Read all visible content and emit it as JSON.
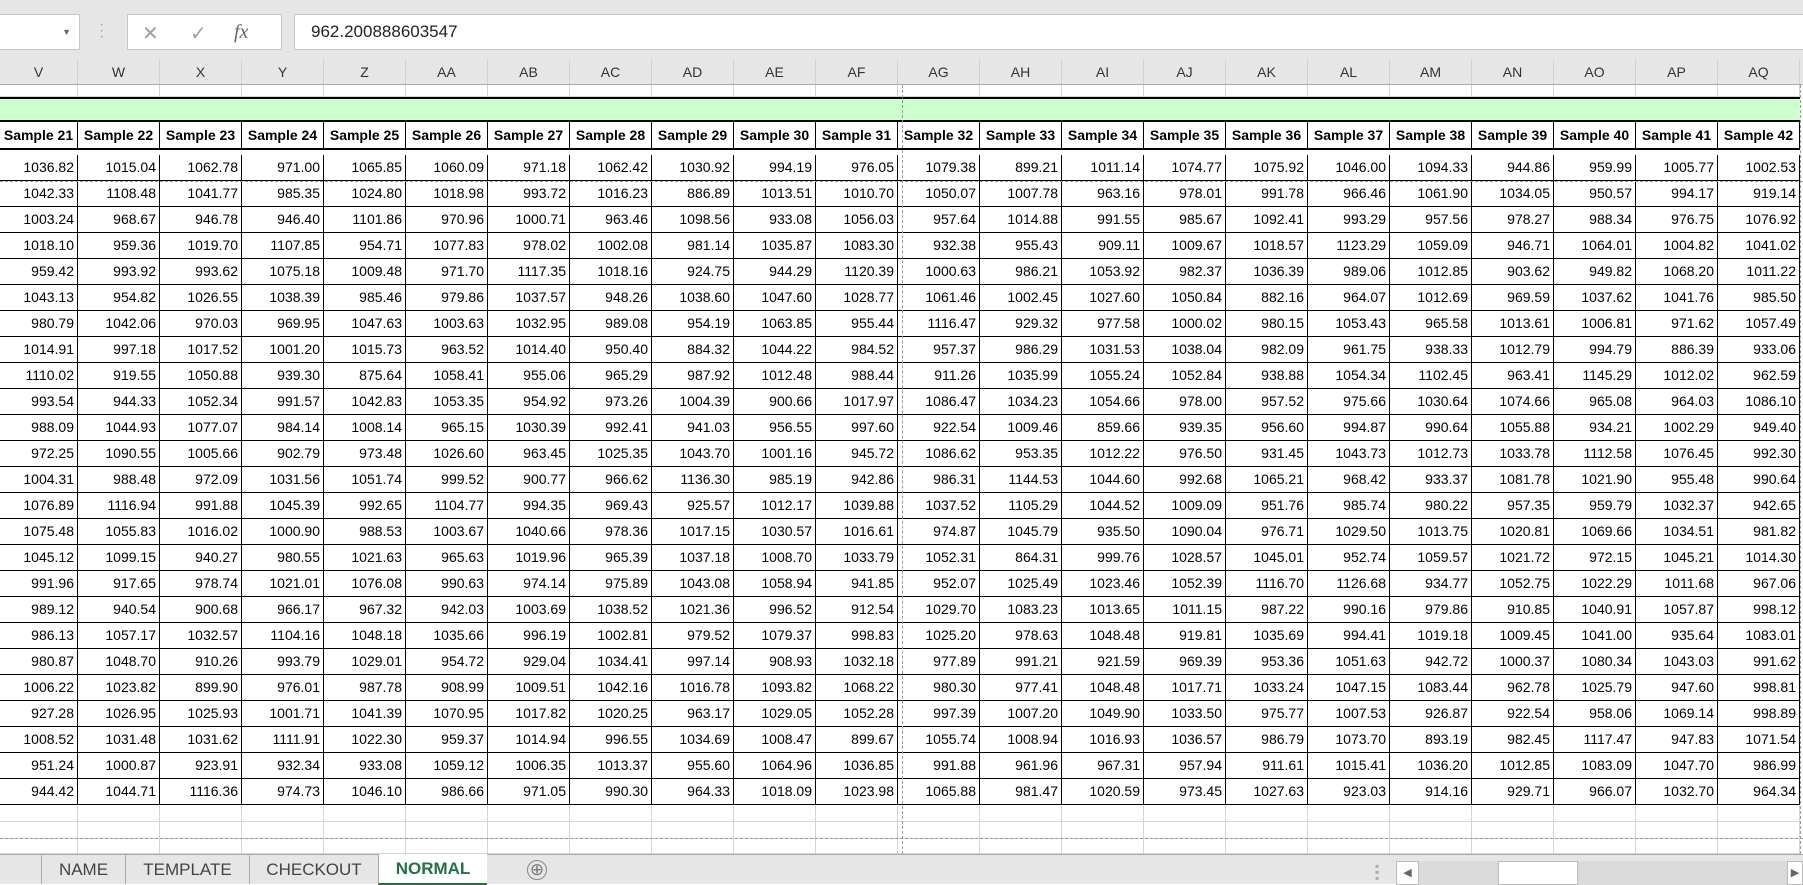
{
  "formula_bar": {
    "name_box": "",
    "cancel_icon": "✕",
    "enter_icon": "✓",
    "fx_label": "fx",
    "value": "962.200888603547"
  },
  "columns": [
    "V",
    "W",
    "X",
    "Y",
    "Z",
    "AA",
    "AB",
    "AC",
    "AD",
    "AE",
    "AF",
    "AG",
    "AH",
    "AI",
    "AJ",
    "AK",
    "AL",
    "AM",
    "AN",
    "AO",
    "AP",
    "AQ"
  ],
  "header_row": [
    "Sample 21",
    "Sample 22",
    "Sample 23",
    "Sample 24",
    "Sample 25",
    "Sample 26",
    "Sample 27",
    "Sample 28",
    "Sample 29",
    "Sample 30",
    "Sample 31",
    "Sample 32",
    "Sample 33",
    "Sample 34",
    "Sample 35",
    "Sample 36",
    "Sample 37",
    "Sample 38",
    "Sample 39",
    "Sample 40",
    "Sample 41",
    "Sample 42"
  ],
  "colors": {
    "header_fill": "#ccffcc",
    "active_tab_text": "#217346",
    "chrome": "#e6e6e6"
  },
  "rows": [
    [
      "1036.82",
      "1015.04",
      "1062.78",
      "971.00",
      "1065.85",
      "1060.09",
      "971.18",
      "1062.42",
      "1030.92",
      "994.19",
      "976.05",
      "1079.38",
      "899.21",
      "1011.14",
      "1074.77",
      "1075.92",
      "1046.00",
      "1094.33",
      "944.86",
      "959.99",
      "1005.77",
      "1002.53"
    ],
    [
      "1042.33",
      "1108.48",
      "1041.77",
      "985.35",
      "1024.80",
      "1018.98",
      "993.72",
      "1016.23",
      "886.89",
      "1013.51",
      "1010.70",
      "1050.07",
      "1007.78",
      "963.16",
      "978.01",
      "991.78",
      "966.46",
      "1061.90",
      "1034.05",
      "950.57",
      "994.17",
      "919.14"
    ],
    [
      "1003.24",
      "968.67",
      "946.78",
      "946.40",
      "1101.86",
      "970.96",
      "1000.71",
      "963.46",
      "1098.56",
      "933.08",
      "1056.03",
      "957.64",
      "1014.88",
      "991.55",
      "985.67",
      "1092.41",
      "993.29",
      "957.56",
      "978.27",
      "988.34",
      "976.75",
      "1076.92"
    ],
    [
      "1018.10",
      "959.36",
      "1019.70",
      "1107.85",
      "954.71",
      "1077.83",
      "978.02",
      "1002.08",
      "981.14",
      "1035.87",
      "1083.30",
      "932.38",
      "955.43",
      "909.11",
      "1009.67",
      "1018.57",
      "1123.29",
      "1059.09",
      "946.71",
      "1064.01",
      "1004.82",
      "1041.02"
    ],
    [
      "959.42",
      "993.92",
      "993.62",
      "1075.18",
      "1009.48",
      "971.70",
      "1117.35",
      "1018.16",
      "924.75",
      "944.29",
      "1120.39",
      "1000.63",
      "986.21",
      "1053.92",
      "982.37",
      "1036.39",
      "989.06",
      "1012.85",
      "903.62",
      "949.82",
      "1068.20",
      "1011.22"
    ],
    [
      "1043.13",
      "954.82",
      "1026.55",
      "1038.39",
      "985.46",
      "979.86",
      "1037.57",
      "948.26",
      "1038.60",
      "1047.60",
      "1028.77",
      "1061.46",
      "1002.45",
      "1027.60",
      "1050.84",
      "882.16",
      "964.07",
      "1012.69",
      "969.59",
      "1037.62",
      "1041.76",
      "985.50"
    ],
    [
      "980.79",
      "1042.06",
      "970.03",
      "969.95",
      "1047.63",
      "1003.63",
      "1032.95",
      "989.08",
      "954.19",
      "1063.85",
      "955.44",
      "1116.47",
      "929.32",
      "977.58",
      "1000.02",
      "980.15",
      "1053.43",
      "965.58",
      "1013.61",
      "1006.81",
      "971.62",
      "1057.49"
    ],
    [
      "1014.91",
      "997.18",
      "1017.52",
      "1001.20",
      "1015.73",
      "963.52",
      "1014.40",
      "950.40",
      "884.32",
      "1044.22",
      "984.52",
      "957.37",
      "986.29",
      "1031.53",
      "1038.04",
      "982.09",
      "961.75",
      "938.33",
      "1012.79",
      "994.79",
      "886.39",
      "933.06"
    ],
    [
      "1110.02",
      "919.55",
      "1050.88",
      "939.30",
      "875.64",
      "1058.41",
      "955.06",
      "965.29",
      "987.92",
      "1012.48",
      "988.44",
      "911.26",
      "1035.99",
      "1055.24",
      "1052.84",
      "938.88",
      "1054.34",
      "1102.45",
      "963.41",
      "1145.29",
      "1012.02",
      "962.59"
    ],
    [
      "993.54",
      "944.33",
      "1052.34",
      "991.57",
      "1042.83",
      "1053.35",
      "954.92",
      "973.26",
      "1004.39",
      "900.66",
      "1017.97",
      "1086.47",
      "1034.23",
      "1054.66",
      "978.00",
      "957.52",
      "975.66",
      "1030.64",
      "1074.66",
      "965.08",
      "964.03",
      "1086.10"
    ],
    [
      "988.09",
      "1044.93",
      "1077.07",
      "984.14",
      "1008.14",
      "965.15",
      "1030.39",
      "992.41",
      "941.03",
      "956.55",
      "997.60",
      "922.54",
      "1009.46",
      "859.66",
      "939.35",
      "956.60",
      "994.87",
      "990.64",
      "1055.88",
      "934.21",
      "1002.29",
      "949.40"
    ],
    [
      "972.25",
      "1090.55",
      "1005.66",
      "902.79",
      "973.48",
      "1026.60",
      "963.45",
      "1025.35",
      "1043.70",
      "1001.16",
      "945.72",
      "1086.62",
      "953.35",
      "1012.22",
      "976.50",
      "931.45",
      "1043.73",
      "1012.73",
      "1033.78",
      "1112.58",
      "1076.45",
      "992.30"
    ],
    [
      "1004.31",
      "988.48",
      "972.09",
      "1031.56",
      "1051.74",
      "999.52",
      "900.77",
      "966.62",
      "1136.30",
      "985.19",
      "942.86",
      "986.31",
      "1144.53",
      "1044.60",
      "992.68",
      "1065.21",
      "968.42",
      "933.37",
      "1081.78",
      "1021.90",
      "955.48",
      "990.64"
    ],
    [
      "1076.89",
      "1116.94",
      "991.88",
      "1045.39",
      "992.65",
      "1104.77",
      "994.35",
      "969.43",
      "925.57",
      "1012.17",
      "1039.88",
      "1037.52",
      "1105.29",
      "1044.52",
      "1009.09",
      "951.76",
      "985.74",
      "980.22",
      "957.35",
      "959.79",
      "1032.37",
      "942.65"
    ],
    [
      "1075.48",
      "1055.83",
      "1016.02",
      "1000.90",
      "988.53",
      "1003.67",
      "1040.66",
      "978.36",
      "1017.15",
      "1030.57",
      "1016.61",
      "974.87",
      "1045.79",
      "935.50",
      "1090.04",
      "976.71",
      "1029.50",
      "1013.75",
      "1020.81",
      "1069.66",
      "1034.51",
      "981.82"
    ],
    [
      "1045.12",
      "1099.15",
      "940.27",
      "980.55",
      "1021.63",
      "965.63",
      "1019.96",
      "965.39",
      "1037.18",
      "1008.70",
      "1033.79",
      "1052.31",
      "864.31",
      "999.76",
      "1028.57",
      "1045.01",
      "952.74",
      "1059.57",
      "1021.72",
      "972.15",
      "1045.21",
      "1014.30"
    ],
    [
      "991.96",
      "917.65",
      "978.74",
      "1021.01",
      "1076.08",
      "990.63",
      "974.14",
      "975.89",
      "1043.08",
      "1058.94",
      "941.85",
      "952.07",
      "1025.49",
      "1023.46",
      "1052.39",
      "1116.70",
      "1126.68",
      "934.77",
      "1052.75",
      "1022.29",
      "1011.68",
      "967.06"
    ],
    [
      "989.12",
      "940.54",
      "900.68",
      "966.17",
      "967.32",
      "942.03",
      "1003.69",
      "1038.52",
      "1021.36",
      "996.52",
      "912.54",
      "1029.70",
      "1083.23",
      "1013.65",
      "1011.15",
      "987.22",
      "990.16",
      "979.86",
      "910.85",
      "1040.91",
      "1057.87",
      "998.12"
    ],
    [
      "986.13",
      "1057.17",
      "1032.57",
      "1104.16",
      "1048.18",
      "1035.66",
      "996.19",
      "1002.81",
      "979.52",
      "1079.37",
      "998.83",
      "1025.20",
      "978.63",
      "1048.48",
      "919.81",
      "1035.69",
      "994.41",
      "1019.18",
      "1009.45",
      "1041.00",
      "935.64",
      "1083.01"
    ],
    [
      "980.87",
      "1048.70",
      "910.26",
      "993.79",
      "1029.01",
      "954.72",
      "929.04",
      "1034.41",
      "997.14",
      "908.93",
      "1032.18",
      "977.89",
      "991.21",
      "921.59",
      "969.39",
      "953.36",
      "1051.63",
      "942.72",
      "1000.37",
      "1080.34",
      "1043.03",
      "991.62"
    ],
    [
      "1006.22",
      "1023.82",
      "899.90",
      "976.01",
      "987.78",
      "908.99",
      "1009.51",
      "1042.16",
      "1016.78",
      "1093.82",
      "1068.22",
      "980.30",
      "977.41",
      "1048.48",
      "1017.71",
      "1033.24",
      "1047.15",
      "1083.44",
      "962.78",
      "1025.79",
      "947.60",
      "998.81"
    ],
    [
      "927.28",
      "1026.95",
      "1025.93",
      "1001.71",
      "1041.39",
      "1070.95",
      "1017.82",
      "1020.25",
      "963.17",
      "1029.05",
      "1052.28",
      "997.39",
      "1007.20",
      "1049.90",
      "1033.50",
      "975.77",
      "1007.53",
      "926.87",
      "922.54",
      "958.06",
      "1069.14",
      "998.89"
    ],
    [
      "1008.52",
      "1031.48",
      "1031.62",
      "1111.91",
      "1022.30",
      "959.37",
      "1014.94",
      "996.55",
      "1034.69",
      "1008.47",
      "899.67",
      "1055.74",
      "1008.94",
      "1016.93",
      "1036.57",
      "986.79",
      "1073.70",
      "893.19",
      "982.45",
      "1117.47",
      "947.83",
      "1071.54"
    ],
    [
      "951.24",
      "1000.87",
      "923.91",
      "932.34",
      "933.08",
      "1059.12",
      "1006.35",
      "1013.37",
      "955.60",
      "1064.96",
      "1036.85",
      "991.88",
      "961.96",
      "967.31",
      "957.94",
      "911.61",
      "1015.41",
      "1036.20",
      "1012.85",
      "1083.09",
      "1047.70",
      "986.99"
    ],
    [
      "944.42",
      "1044.71",
      "1116.36",
      "974.73",
      "1046.10",
      "986.66",
      "971.05",
      "990.30",
      "964.33",
      "1018.09",
      "1023.98",
      "1065.88",
      "981.47",
      "1020.59",
      "973.45",
      "1027.63",
      "923.03",
      "914.16",
      "929.71",
      "966.07",
      "1032.70",
      "964.34"
    ]
  ],
  "sheet_tabs": [
    {
      "label": "NAME",
      "active": false
    },
    {
      "label": "TEMPLATE",
      "active": false
    },
    {
      "label": "CHECKOUT",
      "active": false
    },
    {
      "label": "NORMAL",
      "active": true
    }
  ],
  "add_sheet_icon": "⊕",
  "scroll_left_icon": "◀",
  "scroll_right_icon": "▶"
}
